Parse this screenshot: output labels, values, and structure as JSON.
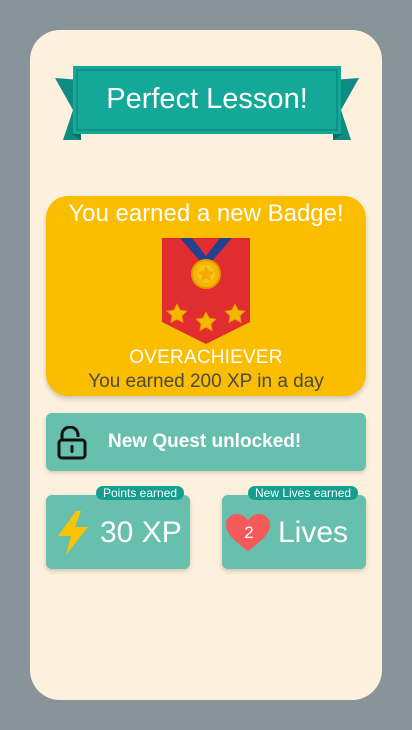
{
  "banner": {
    "title": "Perfect Lesson!"
  },
  "badge": {
    "heading": "You earned a new Badge!",
    "name": "OVERACHIEVER",
    "description": "You earned 200 XP in a day"
  },
  "quest": {
    "label": "New Quest unlocked!",
    "icon": "unlocked-padlock-icon"
  },
  "points": {
    "tag": "Points earned",
    "value": "30 XP",
    "icon": "lightning-bolt-icon"
  },
  "lives": {
    "tag": "New Lives earned",
    "count": "2",
    "label": "Lives",
    "icon": "heart-icon"
  },
  "colors": {
    "background": "#87959b",
    "card": "#fdf0dd",
    "banner": "#14a899",
    "badge_panel": "#fbbd00",
    "tile": "#67bfad",
    "tag": "#139e8e",
    "heart": "#f45a5a",
    "bolt": "#fbc400"
  }
}
